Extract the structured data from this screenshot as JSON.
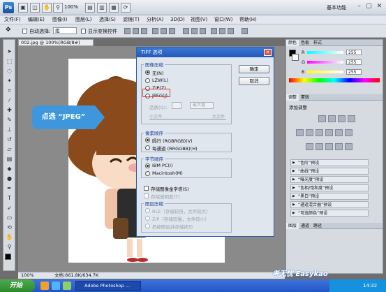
{
  "titlebar": {
    "zoom": "100%",
    "workspace": "基本功能"
  },
  "menu": [
    "文件(F)",
    "编辑(E)",
    "图像(I)",
    "图层(L)",
    "选择(S)",
    "滤镜(T)",
    "分析(A)",
    "3D(D)",
    "视图(V)",
    "窗口(W)",
    "帮助(H)"
  ],
  "options": {
    "auto_select_label": "自动选择:",
    "auto_select_value": "组",
    "show_transform_label": "显示变换控件"
  },
  "document": {
    "tab": "002.jpg @ 100%(RGB/8#)",
    "status_zoom": "100%",
    "status_doc": "文档:661.8K/634.7K"
  },
  "callout": "点选 “JPEG”",
  "dialog": {
    "title": "TIFF 选项",
    "ok": "确定",
    "cancel": "取消",
    "image_compression": {
      "legend": "图像压缩",
      "options": [
        "无(N)",
        "LZW(L)",
        "ZIP(Z)",
        "JPEG(J)"
      ],
      "quality_label": "品质(Q):",
      "quality_select": "最大值",
      "small_file": "小文件",
      "large_file": "大文件"
    },
    "pixel_order": {
      "legend": "像素顺序",
      "options": [
        "隔行 (RGBRGB)(V)",
        "每通道 (RRGGBB)(H)"
      ]
    },
    "byte_order": {
      "legend": "字节顺序",
      "options": [
        "IBM PC(I)",
        "Macintosh(M)"
      ]
    },
    "save_pyramid": "存储图像金字塔(S)",
    "save_transparency": "存储透明度(T)",
    "layer_compression": {
      "legend": "图层压缩",
      "options": [
        "RLE（存储较快，文件较大）",
        "ZIP（存储较慢，文件较小）",
        "扔掉图层并存储拷贝"
      ]
    }
  },
  "panels": {
    "color_tabs": [
      "颜色",
      "色板",
      "样式"
    ],
    "rgb": [
      {
        "label": "R",
        "value": "255"
      },
      {
        "label": "G",
        "value": "255"
      },
      {
        "label": "B",
        "value": "255"
      }
    ],
    "adjust_tabs": [
      "调整",
      "蒙版"
    ],
    "adjust_title": "添加调整",
    "presets": [
      "“色阶”预设",
      "“曲线”预设",
      "“曝光度”预设",
      "“色相/饱和度”预设",
      "“黑白”预设",
      "“通道混合器”预设",
      "“可选颜色”预设"
    ],
    "layers_tabs": [
      "图层",
      "通道",
      "路径"
    ]
  },
  "taskbar": {
    "start": "开始",
    "task": "Adobe Photoshop ...",
    "clock": "14:32"
  },
  "watermark": "考无忧 Easykao",
  "colors": {
    "dialog_title": "#2458b8",
    "highlight": "#e03a3a",
    "callout": "#3e97dd",
    "taskbar": "#2156c6"
  }
}
